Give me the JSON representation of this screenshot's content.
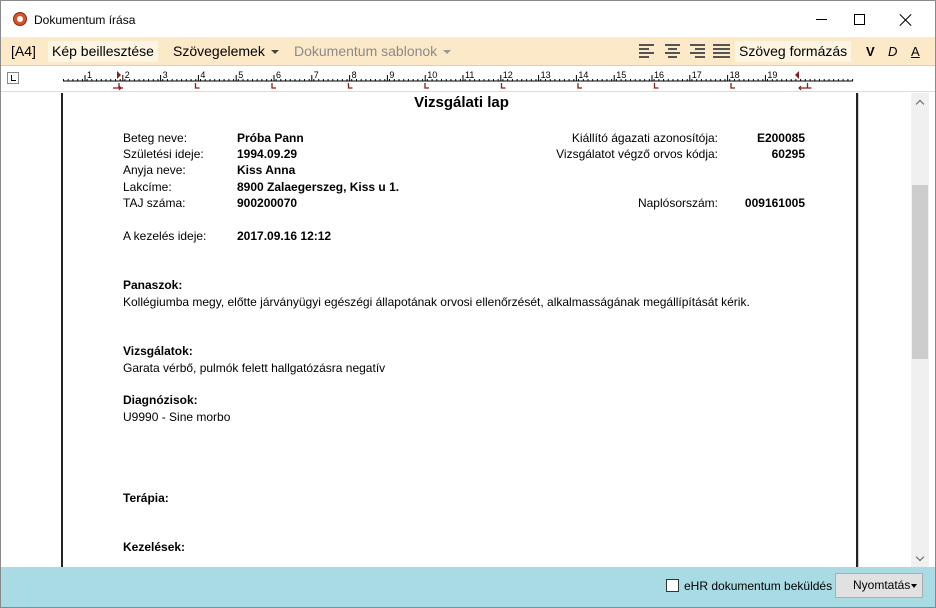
{
  "window": {
    "title": "Dokumentum írása"
  },
  "toolbar": {
    "page_size": "[A4]",
    "insert_image": "Kép beillesztése",
    "text_elements": "Szövegelemek",
    "templates": "Dokumentum sablonok",
    "format_text": "Szöveg formázás",
    "bold": "V",
    "italic": "D",
    "underline": "A",
    "alignment_icons": [
      "align-left-icon",
      "align-center-icon",
      "align-right-icon",
      "align-justify-icon"
    ]
  },
  "ruler": {
    "numbers": [
      "1",
      "2",
      "3",
      "4",
      "5",
      "6",
      "7",
      "8",
      "9",
      "10",
      "11",
      "12",
      "13",
      "14",
      "15",
      "16",
      "17",
      "18",
      "19"
    ],
    "marker_color": "#8b1a1a"
  },
  "document": {
    "title": "Vizsgálati lap",
    "patient": [
      {
        "label": "Beteg neve:",
        "value": "Próba Pann"
      },
      {
        "label": "Születési ideje:",
        "value": "1994.09.29"
      },
      {
        "label": "Anyja neve:",
        "value": "Kiss Anna"
      },
      {
        "label": "Lakcíme:",
        "value": "8900 Zalaegerszeg, Kiss u 1."
      },
      {
        "label": "TAJ száma:",
        "value": "900200070"
      }
    ],
    "issuer": [
      {
        "label": "Kiállító ágazati azonosítója:",
        "value": "E200085"
      },
      {
        "label": "Vizsgálatot végző orvos kódja:",
        "value": "60295"
      }
    ],
    "log_number": {
      "label": "Naplósorszám:",
      "value": "009161005"
    },
    "treatment_time": {
      "label": "A kezelés ideje:",
      "value": "2017.09.16 12:12"
    },
    "sections": [
      {
        "heading": "Panaszok:",
        "text": "Kollégiumba megy, előtte járványügyi egészégi állapotának orvosi ellenőrzését, alkalmasságának  megállípítását kérik."
      },
      {
        "heading": "Vizsgálatok:",
        "text": "Garata vérbő, pulmók felett hallgatózásra negatív"
      },
      {
        "heading": "Diagnózisok:",
        "text": "U9990 - Sine morbo"
      },
      {
        "heading": "Terápia:",
        "text": ""
      },
      {
        "heading": "Kezelések:",
        "text": ""
      }
    ]
  },
  "footer": {
    "ehr_checkbox_label": "eHR dokumentum beküldés",
    "ehr_checked": false,
    "print_button": "Nyomtatás"
  },
  "colors": {
    "toolbar_bg": "#fbe9c8",
    "footer_bg": "#a9dbe5"
  }
}
